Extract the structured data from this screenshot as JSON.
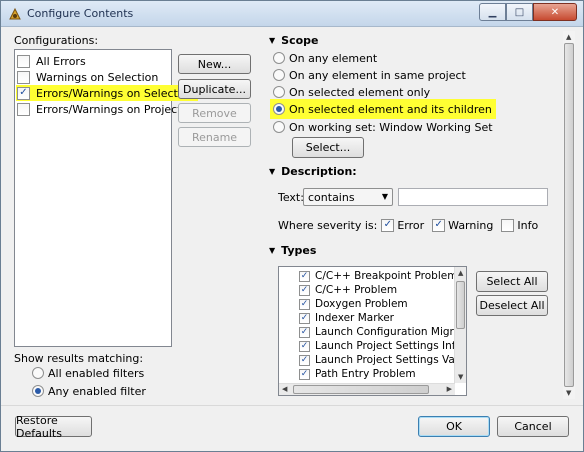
{
  "window": {
    "title": "Configure Contents",
    "min_glyph": "▁",
    "max_glyph": "□",
    "close_glyph": "✕"
  },
  "configurations": {
    "label": "Configurations:",
    "items": [
      {
        "label": "All Errors",
        "checked": false,
        "highlighted": false
      },
      {
        "label": "Warnings on Selection",
        "checked": false,
        "highlighted": false
      },
      {
        "label": "Errors/Warnings on Selection",
        "checked": true,
        "highlighted": true
      },
      {
        "label": "Errors/Warnings on Project",
        "checked": false,
        "highlighted": false
      }
    ],
    "buttons": {
      "new": "New...",
      "duplicate": "Duplicate...",
      "remove": "Remove",
      "rename": "Rename"
    }
  },
  "show_results": {
    "label": "Show results matching:",
    "options": [
      {
        "label": "All enabled filters",
        "selected": false
      },
      {
        "label": "Any enabled filter",
        "selected": true
      }
    ]
  },
  "scope": {
    "title": "Scope",
    "options": [
      {
        "label": "On any element",
        "selected": false,
        "highlighted": false
      },
      {
        "label": "On any element in same project",
        "selected": false,
        "highlighted": false
      },
      {
        "label": "On selected element only",
        "selected": false,
        "highlighted": false
      },
      {
        "label": "On selected element and its children",
        "selected": true,
        "highlighted": true
      },
      {
        "label": "On working set:  Window Working Set",
        "selected": false,
        "highlighted": false
      }
    ],
    "select_button": "Select..."
  },
  "description": {
    "title": "Description:",
    "text_label": "Text:",
    "match_mode": "contains",
    "text_value": "",
    "severity_label": "Where severity is:",
    "severities": [
      {
        "label": "Error",
        "checked": true
      },
      {
        "label": "Warning",
        "checked": true
      },
      {
        "label": "Info",
        "checked": false
      }
    ]
  },
  "types": {
    "title": "Types",
    "items": [
      {
        "label": "C/C++ Breakpoint Problem",
        "checked": true
      },
      {
        "label": "C/C++ Problem",
        "checked": true
      },
      {
        "label": "Doxygen Problem",
        "checked": true
      },
      {
        "label": "Indexer Marker",
        "checked": true
      },
      {
        "label": "Launch Configuration Migration",
        "checked": true
      },
      {
        "label": "Launch Project Settings Info",
        "checked": true
      },
      {
        "label": "Launch Project Settings Validation",
        "checked": true
      },
      {
        "label": "Path Entry Problem",
        "checked": true
      }
    ],
    "select_all": "Select All",
    "deselect_all": "Deselect All"
  },
  "footer": {
    "restore_defaults": "Restore Defaults",
    "ok": "OK",
    "cancel": "Cancel"
  },
  "highlight_color": "#ffff33",
  "check_glyph": "✓",
  "collapse_glyph": "▼"
}
